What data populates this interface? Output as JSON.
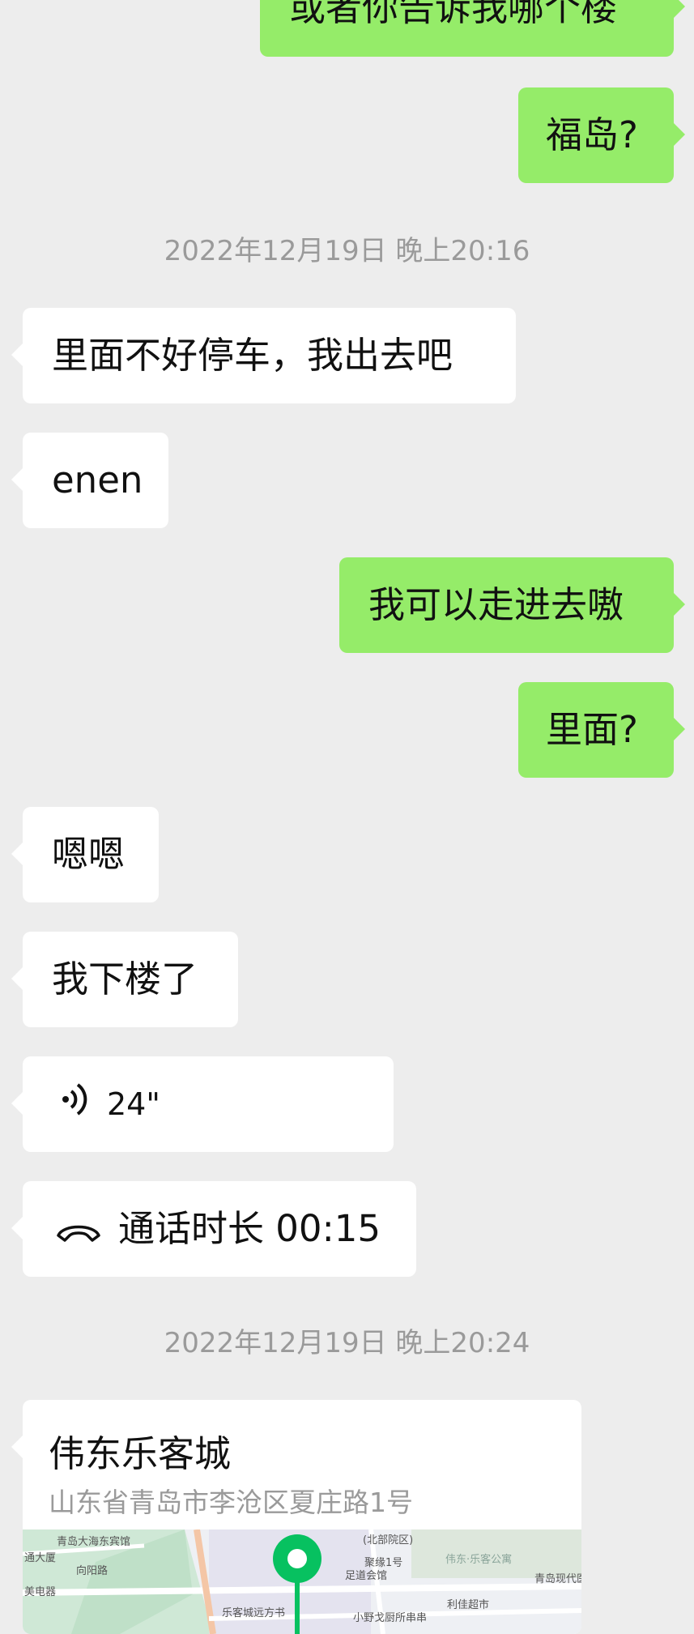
{
  "messages": {
    "m1": "或者你告诉我哪个楼",
    "m2": "福岛?",
    "t1": "2022年12月19日 晚上20:16",
    "m3": "里面不好停车，我出去吧",
    "m4": "enen",
    "m5": "我可以走进去嗷",
    "m6": "里面?",
    "m7": "嗯嗯",
    "m8": "我下楼了",
    "voice_duration": "24\"",
    "call_text": "通话时长 00:15",
    "t2": "2022年12月19日 晚上20:24"
  },
  "location": {
    "title": "伟东乐客城",
    "address": "山东省青岛市李沧区夏庄路1号",
    "map_labels": {
      "l1": "青岛大海东宾馆",
      "l2": "通大厦",
      "l3": "向阳路",
      "l4": "美电器",
      "l5": "(北部院区)",
      "l6": "聚缘1号",
      "l7": "足道会馆",
      "l8": "伟东·乐客公寓",
      "l9": "青岛现代医",
      "l10": "乐客城远方书",
      "l11": "利佳超市",
      "l12": "小野戈厨所串串"
    }
  },
  "colors": {
    "self_bubble": "#95ec69",
    "other_bubble": "#ffffff",
    "background": "#ededed",
    "pin": "#07c160"
  }
}
